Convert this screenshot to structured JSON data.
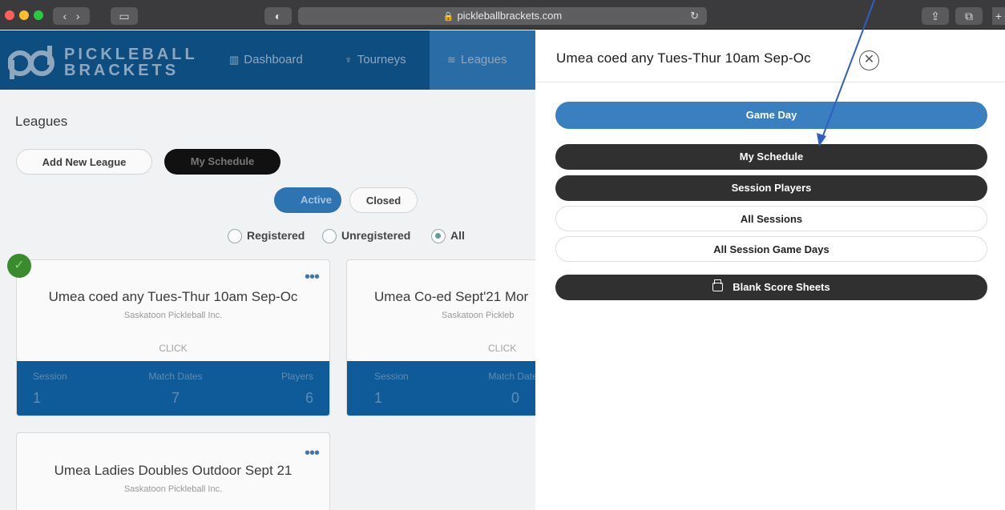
{
  "browser": {
    "url": "pickleballbrackets.com",
    "lock_icon": "🔒",
    "reload_icon": "↻"
  },
  "app": {
    "logo_line1": "PICKLEBALL",
    "logo_line2": "BRACKETS",
    "nav": [
      {
        "label": "Dashboard",
        "icon": "chart-icon"
      },
      {
        "label": "Tourneys",
        "icon": "trophy-icon"
      },
      {
        "label": "Leagues",
        "icon": "layers-icon",
        "active": true
      }
    ]
  },
  "leagues": {
    "title": "Leagues",
    "add_new": "Add New League",
    "my_schedule": "My Schedule",
    "filter_active": "Active",
    "filter_closed": "Closed",
    "radios": [
      {
        "label": "Registered",
        "checked": false
      },
      {
        "label": "Unregistered",
        "checked": false
      },
      {
        "label": "All",
        "checked": true
      }
    ],
    "cards": [
      {
        "title": "Umea coed any Tues-Thur 10am Sep-Oc",
        "org": "Saskatoon Pickleball Inc.",
        "cta": "CLICK",
        "stats": [
          {
            "label": "Session",
            "value": "1"
          },
          {
            "label": "Match Dates",
            "value": "7"
          },
          {
            "label": "Players",
            "value": "6"
          }
        ],
        "registered": true
      },
      {
        "title": "Umea Co-ed Sept'21 Mor",
        "org": "Saskatoon Pickleb",
        "cta": "CLICK",
        "stats": [
          {
            "label": "Session",
            "value": "1"
          },
          {
            "label": "Match Dates",
            "value": "0"
          }
        ]
      },
      {
        "title": "Umea Ladies Doubles Outdoor Sept 21",
        "org": "Saskatoon Pickleball Inc."
      }
    ]
  },
  "panel": {
    "title": "Umea coed any Tues-Thur 10am Sep-Oc",
    "close_glyph": "✕",
    "buttons": {
      "game_day": "Game Day",
      "my_schedule": "My Schedule",
      "session_players": "Session Players",
      "all_sessions": "All Sessions",
      "all_session_game_days": "All Session Game Days",
      "blank_score_sheets": "Blank Score Sheets"
    }
  },
  "colors": {
    "brand_blue": "#0d4d80",
    "primary_button": "#3a80c0",
    "dark_button": "#303030",
    "annotation_arrow": "#2f5fc4"
  }
}
